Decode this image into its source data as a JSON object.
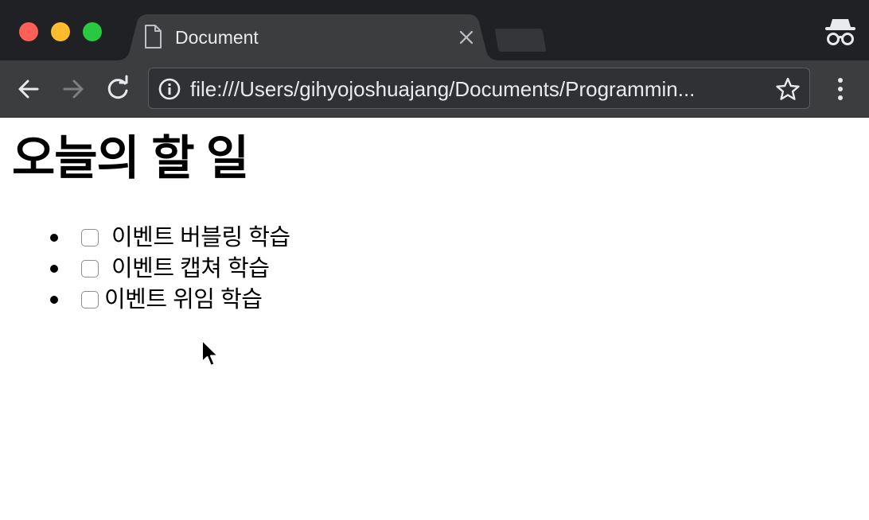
{
  "browser": {
    "tab": {
      "title": "Document",
      "icon": "document-icon"
    },
    "address_bar": {
      "url": "file:///Users/gihyojoshuajang/Documents/Programmin...",
      "info_icon": "info-icon",
      "bookmark_icon": "star-icon"
    },
    "mode": "incognito"
  },
  "page": {
    "heading": "오늘의 할 일",
    "todos": [
      {
        "label": "이벤트 버블링 학습",
        "checked": false
      },
      {
        "label": "이벤트 캡쳐 학습",
        "checked": false
      },
      {
        "label": "이벤트 위임 학습",
        "checked": false
      }
    ]
  },
  "colors": {
    "tabstrip_bg": "#202124",
    "toolbar_bg": "#3c3d3f",
    "omnibox_bg": "#303134",
    "page_bg": "#ffffff",
    "close_red": "#fe5f57",
    "minimize_yellow": "#febc2e",
    "zoom_green": "#28c840"
  }
}
